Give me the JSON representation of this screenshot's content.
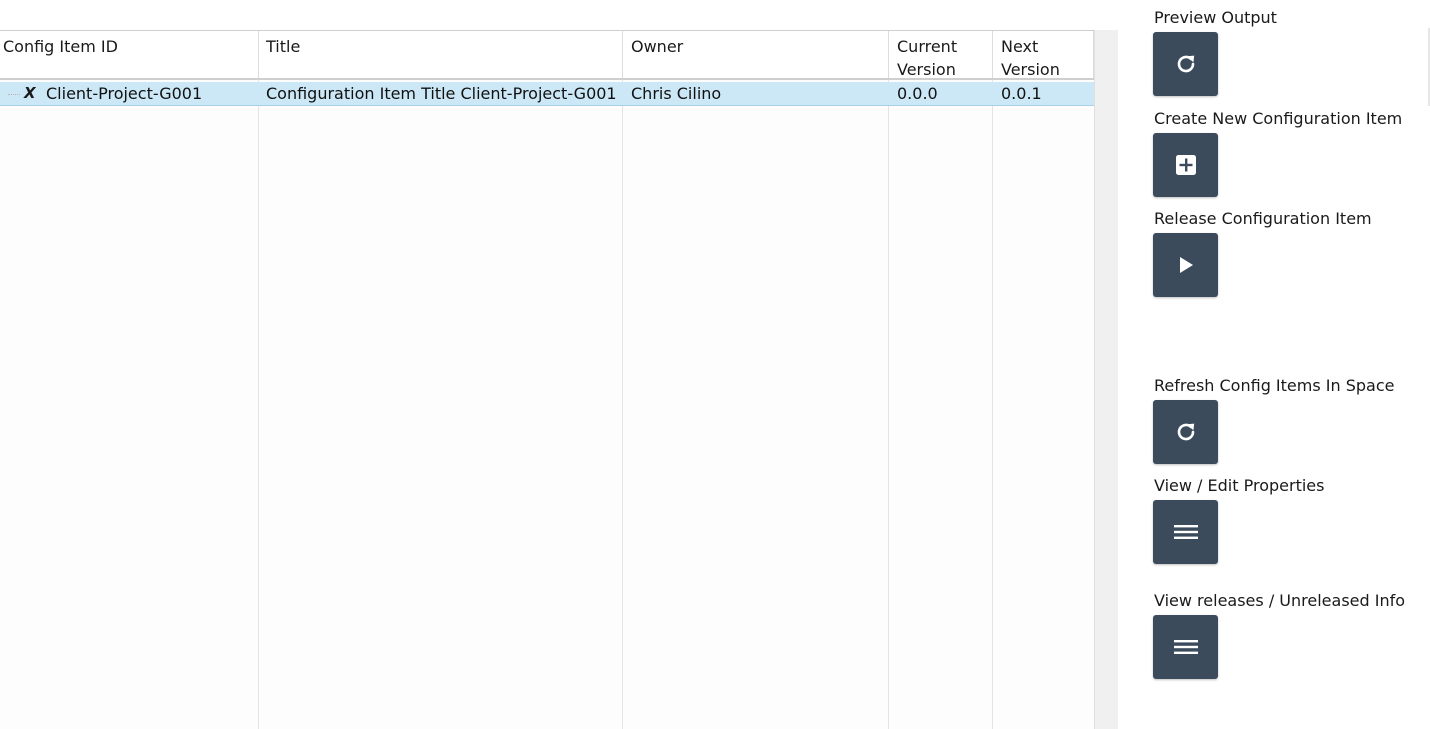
{
  "grid": {
    "columns": [
      {
        "label": "Config Item ID"
      },
      {
        "label": "Title"
      },
      {
        "label": "Owner"
      },
      {
        "label": "Current\nVersion"
      },
      {
        "label": "Next\nVersion"
      }
    ],
    "rows": [
      {
        "marker": "X",
        "config_item_id": "Client-Project-G001",
        "title": "Configuration Item Title Client-Project-G001",
        "owner": "Chris Cilino",
        "current_version": "0.0.0",
        "next_version": "0.0.1"
      }
    ],
    "selected_row_color": "#cce8f7"
  },
  "actions": [
    {
      "label": "Preview Output",
      "icon": "refresh-icon"
    },
    {
      "label": "Create New Configuration Item",
      "icon": "plus-square-icon"
    },
    {
      "label": "Release Configuration Item",
      "icon": "play-icon"
    },
    {
      "label": "Refresh Config Items In Space",
      "icon": "refresh-icon"
    },
    {
      "label": "View / Edit Properties",
      "icon": "menu-icon"
    },
    {
      "label": "View releases / Unreleased Info",
      "icon": "menu-icon"
    }
  ],
  "button_color": "#3c4b5c"
}
